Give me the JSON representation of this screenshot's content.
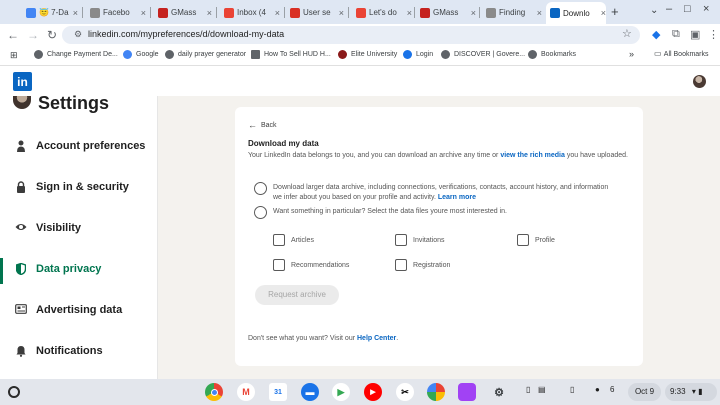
{
  "browser": {
    "tabs": [
      {
        "title": "😇 7-Da",
        "favicon_color": "#4285f4"
      },
      {
        "title": "Facebo",
        "favicon_color": "#8a8a8a"
      },
      {
        "title": "GMass",
        "favicon_color": "#c5221f"
      },
      {
        "title": "Inbox (4",
        "favicon_color": "#ea4335"
      },
      {
        "title": "User se",
        "favicon_color": "#d93025"
      },
      {
        "title": "Let's do",
        "favicon_color": "#ea4335"
      },
      {
        "title": "GMass",
        "favicon_color": "#c5221f"
      },
      {
        "title": "Finding",
        "favicon_color": "#8a8a8a"
      },
      {
        "title": "Downlo",
        "favicon_color": "#0a66c2",
        "active": true
      }
    ],
    "url": "linkedin.com/mypreferences/d/download-my-data",
    "bookmarks": [
      {
        "label": "Change Payment De...",
        "icon_color": "#5f6368"
      },
      {
        "label": "Google",
        "icon_color": "#4285f4"
      },
      {
        "label": "daily prayer generator",
        "icon_color": "#5f6368"
      },
      {
        "label": "How To Sell HUD H...",
        "icon_color": "#5f6368"
      },
      {
        "label": "Elite University",
        "icon_color": "#8b1a1a"
      },
      {
        "label": "Login",
        "icon_color": "#1a73e8"
      },
      {
        "label": "DISCOVER | Govere...",
        "icon_color": "#5f6368"
      },
      {
        "label": "Bookmarks",
        "icon_color": "#5f6368"
      }
    ],
    "all_bookmarks_label": "All Bookmarks"
  },
  "linkedin": {
    "logo_text": "in",
    "brand_color": "#0a66c2",
    "active_color": "#01754f"
  },
  "sidebar": {
    "title": "Settings",
    "items": [
      {
        "label": "Account preferences",
        "icon": "person-icon"
      },
      {
        "label": "Sign in & security",
        "icon": "lock-icon"
      },
      {
        "label": "Visibility",
        "icon": "eye-icon"
      },
      {
        "label": "Data privacy",
        "icon": "shield-icon",
        "active": true
      },
      {
        "label": "Advertising data",
        "icon": "newspaper-icon"
      },
      {
        "label": "Notifications",
        "icon": "bell-icon"
      }
    ]
  },
  "main": {
    "back_label": "Back",
    "title": "Download my data",
    "desc_prefix": "Your LinkedIn data belongs to you, and you can download an archive any time or ",
    "desc_link": "view the rich media",
    "desc_suffix": " you have uploaded.",
    "option_larger_text": "Download larger data archive, including connections, verifications, contacts, account history, and information we infer about you based on your profile and activity. ",
    "option_larger_link": "Learn more",
    "option_particular_text": "Want something in particular? Select the data files youre most interested in.",
    "checkboxes": [
      "Articles",
      "Invitations",
      "Profile",
      "Recommendations",
      "Registration"
    ],
    "request_button": "Request archive",
    "help_prefix": "Don't see what you want? Visit our ",
    "help_link": "Help Center",
    "help_suffix": "."
  },
  "taskbar": {
    "date": "Oct 9",
    "time": "9:33",
    "notification_count": "6"
  }
}
